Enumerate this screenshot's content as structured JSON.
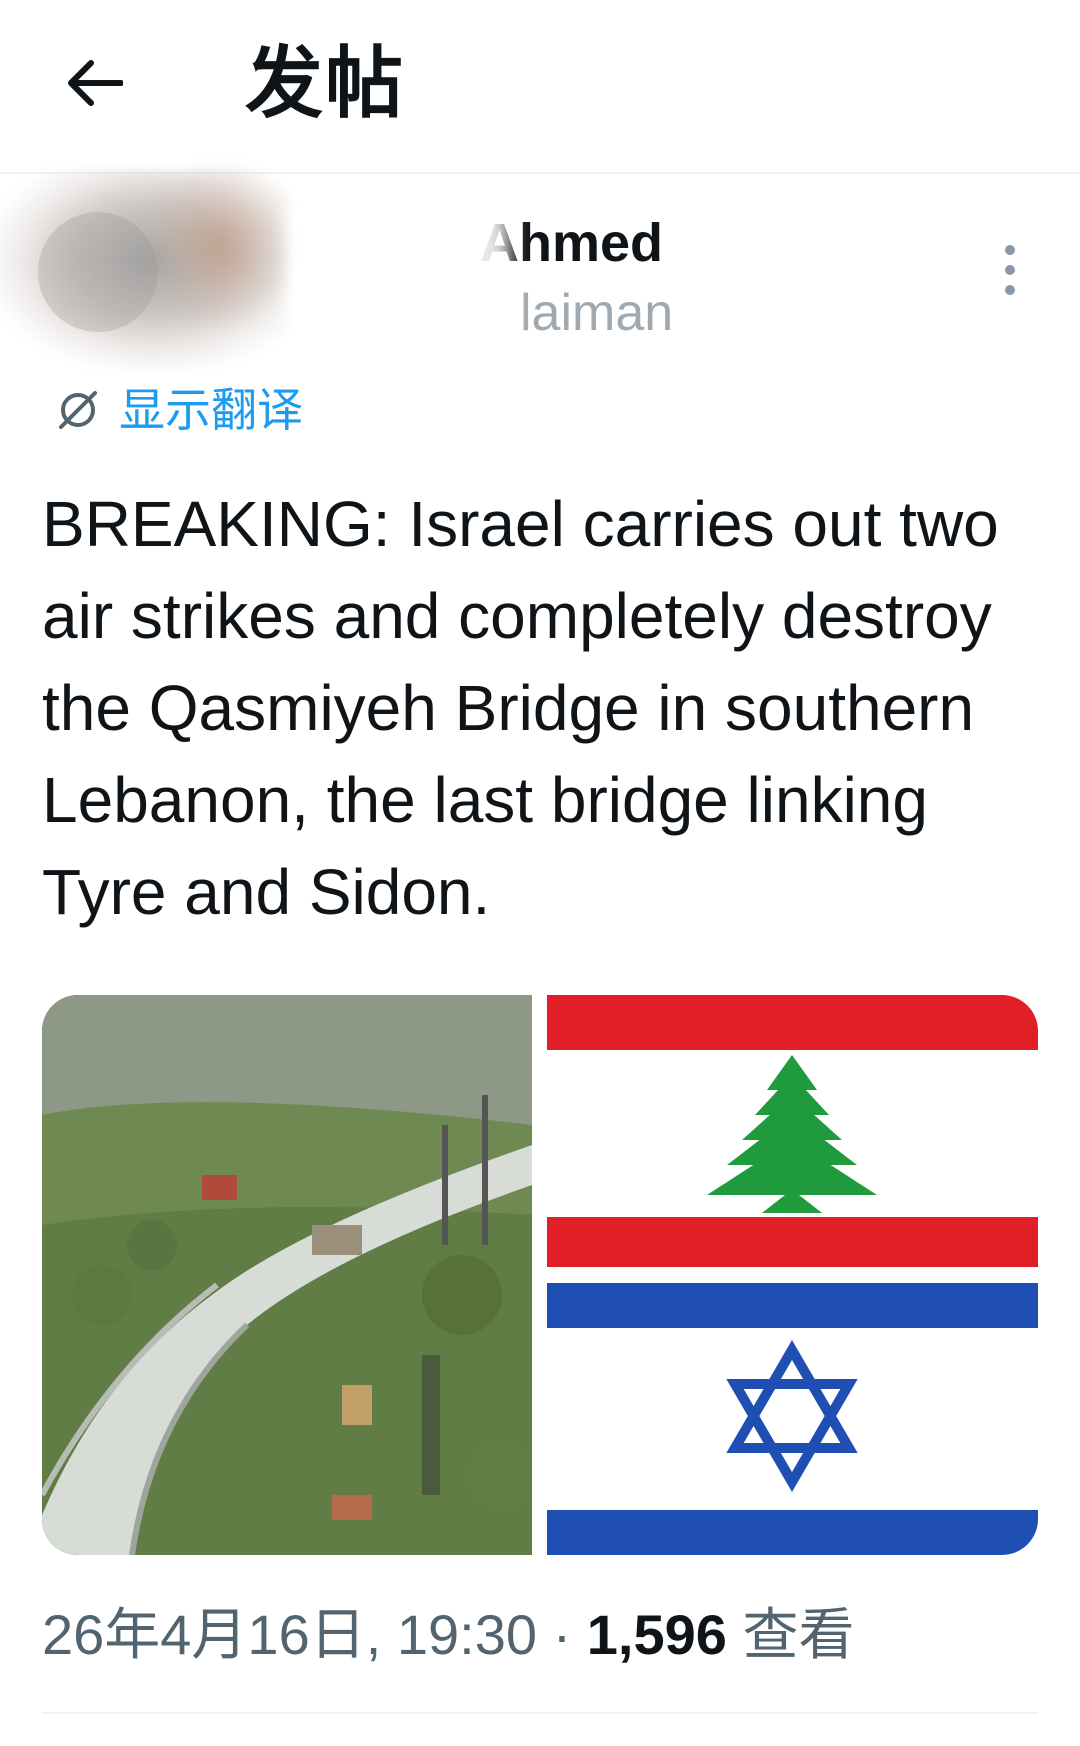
{
  "header": {
    "title": "发帖",
    "back_icon": "arrow-left-icon"
  },
  "author": {
    "display_name": "Ahmed",
    "handle": "laiman",
    "more_icon": "more-vertical-icon"
  },
  "translate": {
    "label": "显示翻译",
    "icon": "globe-translate-icon"
  },
  "tweet": {
    "text": "BREAKING: Israel carries out two air strikes and completely destroy the Qasmiyeh Bridge in southern Lebanon, the last bridge linking Tyre and Sidon."
  },
  "media": {
    "left": "bridge-photo",
    "right": "lebanon-israel-flags"
  },
  "meta": {
    "date": "26年4月16日",
    "time": "19:30",
    "separator": "·",
    "views_count": "1,596",
    "views_label": "查看"
  },
  "colors": {
    "link_blue": "#1d9bf0",
    "text": "#0f1419",
    "secondary": "#536471",
    "lebanon_red": "#e21e26",
    "lebanon_green": "#1f9a3c",
    "israel_blue": "#1f4fb3"
  }
}
